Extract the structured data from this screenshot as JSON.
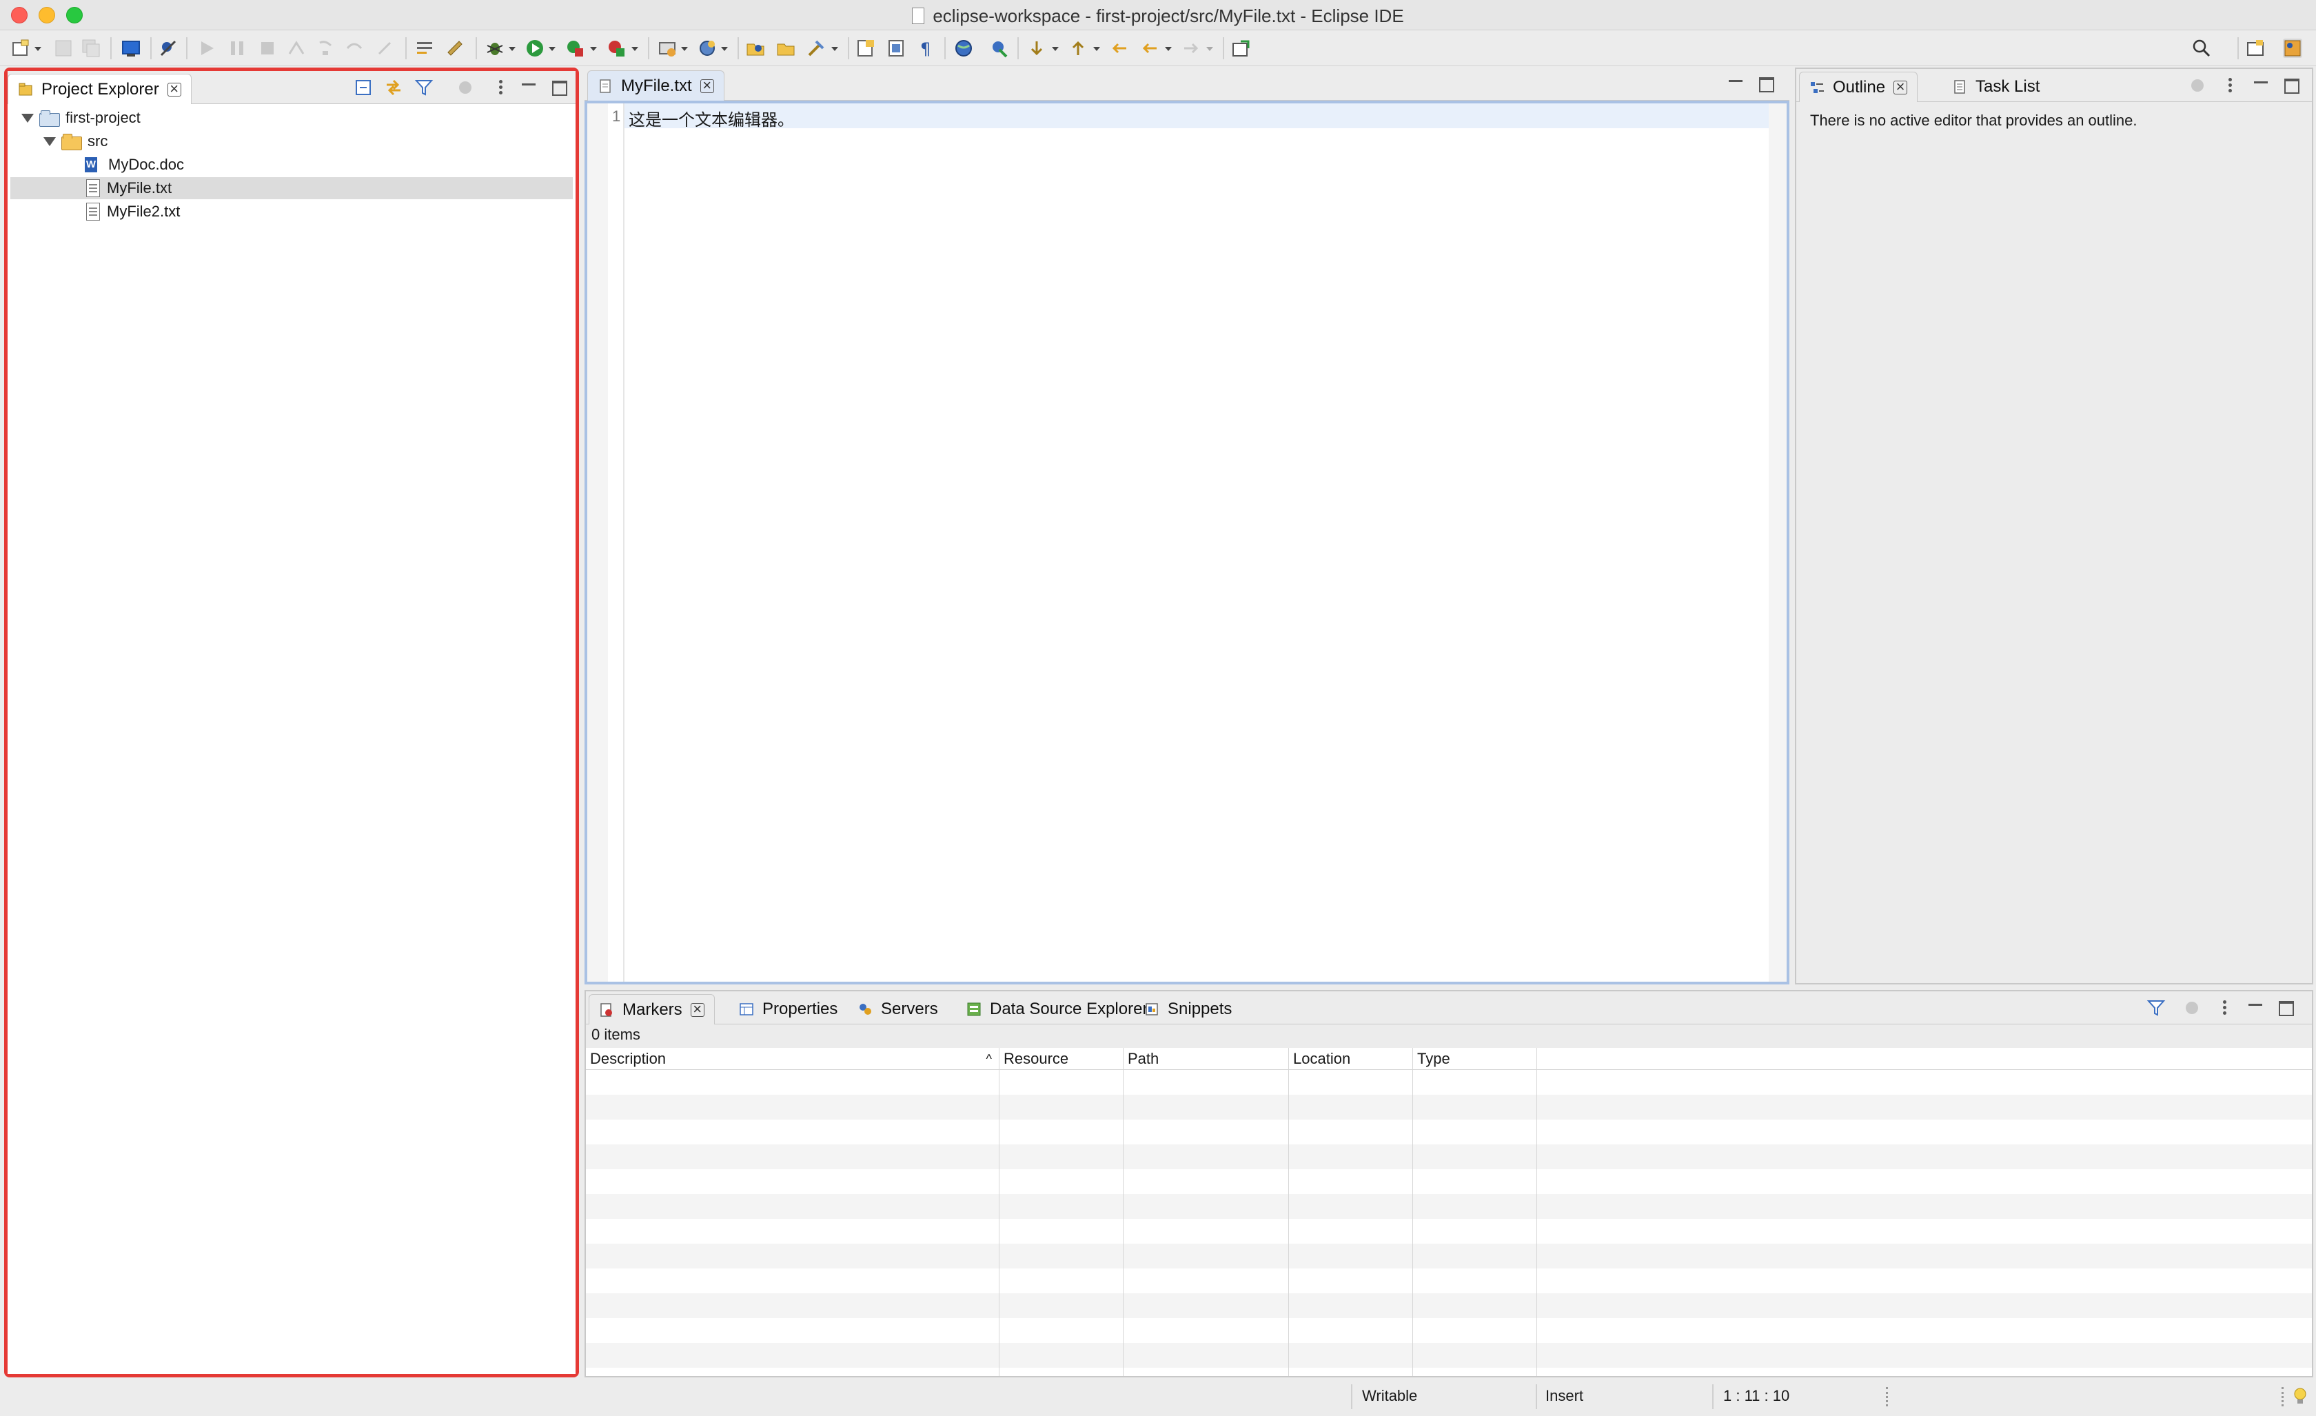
{
  "window": {
    "title": "eclipse-workspace - first-project/src/MyFile.txt - Eclipse IDE"
  },
  "toolbar": {
    "icons": [
      "new-icon",
      "save-icon",
      "save-all-icon",
      "terminal-icon",
      "skip-breakpoints-icon",
      "resume-icon",
      "suspend-icon",
      "terminate-icon",
      "disconnect-icon",
      "step-into-icon",
      "step-over-icon",
      "step-return-icon",
      "toggle-mark-icon",
      "build-icon",
      "debug-icon",
      "run-icon",
      "coverage-icon",
      "external-tools-icon",
      "new-server-icon",
      "new-web-service-icon",
      "open-type-icon",
      "open-task-icon",
      "search-references-icon",
      "toggle-ant-editor-icon",
      "toggle-block-icon",
      "show-whitespace-icon",
      "web-browser-icon",
      "external-browser-icon",
      "next-annotation-icon",
      "previous-annotation-icon",
      "back-icon",
      "forward-icon",
      "new-window-icon",
      "search-icon",
      "open-perspective-icon",
      "java-ee-perspective-icon"
    ]
  },
  "project_explorer": {
    "tab_label": "Project Explorer",
    "tree": [
      {
        "label": "first-project",
        "type": "project",
        "expanded": true,
        "depth": 0
      },
      {
        "label": "src",
        "type": "folder",
        "expanded": true,
        "depth": 1
      },
      {
        "label": "MyDoc.doc",
        "type": "doc",
        "depth": 2
      },
      {
        "label": "MyFile.txt",
        "type": "txt",
        "depth": 2,
        "selected": true
      },
      {
        "label": "MyFile2.txt",
        "type": "txt",
        "depth": 2
      }
    ]
  },
  "editor": {
    "tab_label": "MyFile.txt",
    "line_number": "1",
    "content": "这是一个文本编辑器。"
  },
  "outline": {
    "tab_label": "Outline",
    "tab2_label": "Task List",
    "message": "There is no active editor that provides an outline."
  },
  "bottom_panel": {
    "tabs": [
      "Markers",
      "Properties",
      "Servers",
      "Data Source Explorer",
      "Snippets"
    ],
    "item_count": "0 items",
    "columns": [
      "Description",
      "Resource",
      "Path",
      "Location",
      "Type"
    ]
  },
  "status_bar": {
    "writable": "Writable",
    "insert_mode": "Insert",
    "position": "1 : 11 : 10"
  },
  "colors": {
    "highlight_border": "#e53935",
    "editor_border": "#a9c1e4",
    "selection": "#dcdcdc"
  }
}
